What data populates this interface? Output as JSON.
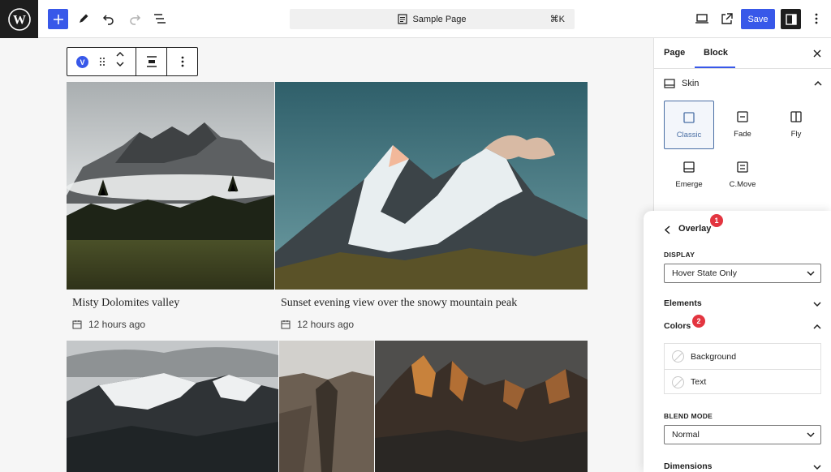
{
  "topbar": {
    "document_title": "Sample Page",
    "shortcut": "⌘K",
    "save_label": "Save"
  },
  "block_toolbar": {
    "block_badge": "V"
  },
  "posts": [
    {
      "title": "Misty Dolomites valley",
      "time": "12 hours ago"
    },
    {
      "title": "Sunset evening view over the snowy mountain peak",
      "time": "12 hours ago"
    }
  ],
  "sidebar": {
    "tabs": [
      {
        "label": "Page",
        "active": false
      },
      {
        "label": "Block",
        "active": true
      }
    ],
    "skin": {
      "label": "Skin",
      "options": [
        {
          "label": "Classic",
          "icon": "square-icon",
          "active": true
        },
        {
          "label": "Fade",
          "icon": "minus-square-icon",
          "active": false
        },
        {
          "label": "Fly",
          "icon": "split-square-icon",
          "active": false
        },
        {
          "label": "Emerge",
          "icon": "bottom-bar-square-icon",
          "active": false
        },
        {
          "label": "C.Move",
          "icon": "stacked-square-icon",
          "active": false
        }
      ]
    }
  },
  "overlay": {
    "title": "Overlay",
    "badge_1": "1",
    "badge_2": "2",
    "display": {
      "label": "DISPLAY",
      "value": "Hover State Only"
    },
    "elements_label": "Elements",
    "colors_label": "Colors",
    "colors": [
      {
        "label": "Background"
      },
      {
        "label": "Text"
      }
    ],
    "blend_mode": {
      "label": "BLEND MODE",
      "value": "Normal"
    },
    "dimensions_label": "Dimensions"
  },
  "theme": {
    "accent": "#3858e9",
    "badge": "#e33540",
    "skin_active": "#4a6fa5"
  }
}
